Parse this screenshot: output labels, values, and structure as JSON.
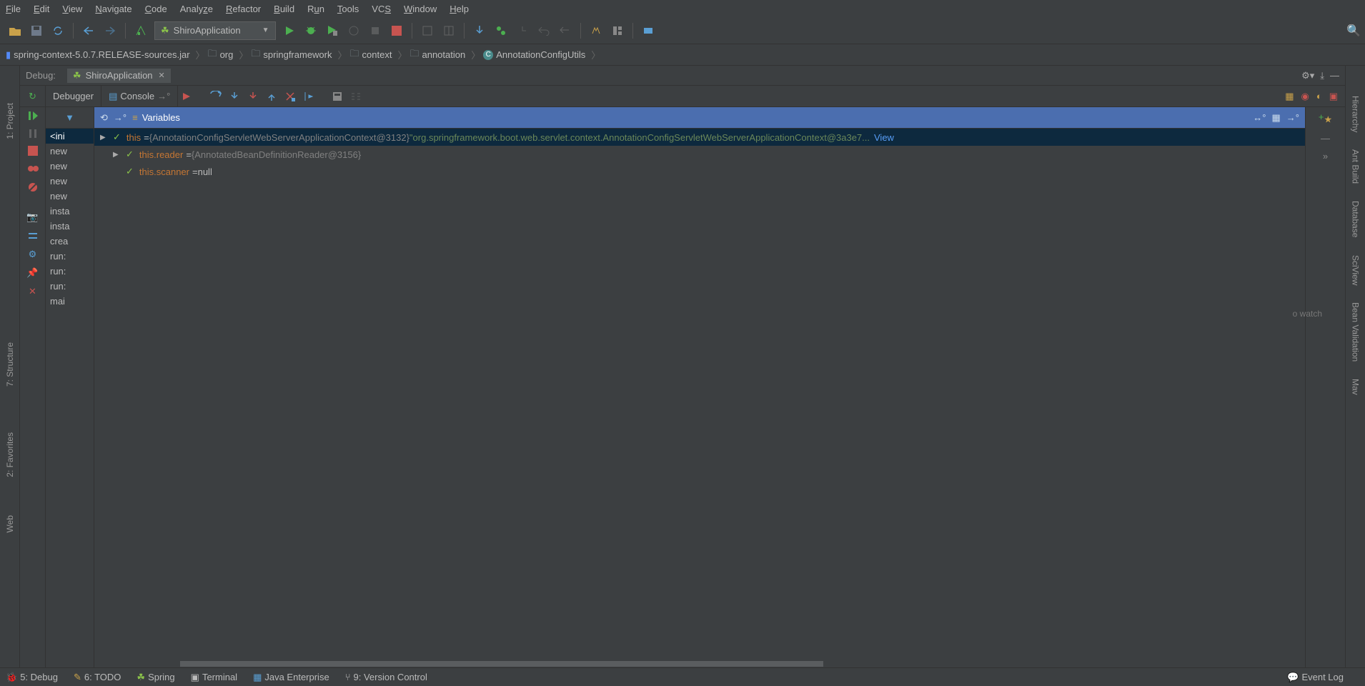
{
  "menu": {
    "file": "File",
    "edit": "Edit",
    "view": "View",
    "navigate": "Navigate",
    "code": "Code",
    "analyze": "Analyze",
    "refactor": "Refactor",
    "build": "Build",
    "run": "Run",
    "tools": "Tools",
    "vcs": "VCS",
    "window": "Window",
    "help": "Help"
  },
  "runConfig": {
    "name": "ShiroApplication"
  },
  "breadcrumb": [
    {
      "icon": "archive",
      "text": "spring-context-5.0.7.RELEASE-sources.jar"
    },
    {
      "icon": "folder",
      "text": "org"
    },
    {
      "icon": "folder",
      "text": "springframework"
    },
    {
      "icon": "folder",
      "text": "context"
    },
    {
      "icon": "folder",
      "text": "annotation"
    },
    {
      "icon": "class",
      "text": "AnnotationConfigUtils"
    }
  ],
  "leftTools": {
    "project": "1: Project",
    "structure": "7: Structure",
    "favorites": "2: Favorites",
    "web": "Web"
  },
  "rightTools": {
    "hierarchy": "Hierarchy",
    "antbuild": "Ant Build",
    "database": "Database",
    "sciview": "SciView",
    "beanval": "Bean Validation",
    "mav": "Mav"
  },
  "debug": {
    "label": "Debug:",
    "tab": "ShiroApplication",
    "debuggerTab": "Debugger",
    "consoleTab": "Console",
    "variablesLabel": "Variables"
  },
  "frames": [
    "<ini",
    "new",
    "new",
    "new",
    "new",
    "insta",
    "insta",
    "crea",
    "run:",
    "run:",
    "run:",
    "mai"
  ],
  "variables": [
    {
      "indent": 0,
      "arrow": "▶",
      "name": "this",
      "eq": " = ",
      "type": "{AnnotationConfigServletWebServerApplicationContext@3132}",
      "str": " \"org.springframework.boot.web.servlet.context.AnnotationConfigServletWebServerApplicationContext@3a3e7...",
      "view": "View",
      "selected": true
    },
    {
      "indent": 1,
      "arrow": "▶",
      "name": "this.reader",
      "eq": " = ",
      "type": "{AnnotatedBeanDefinitionReader@3156}",
      "str": "",
      "view": "",
      "selected": false
    },
    {
      "indent": 1,
      "arrow": "",
      "name": "this.scanner",
      "eq": " = ",
      "type": "",
      "str": "",
      "null": "null",
      "view": "",
      "selected": false
    }
  ],
  "watchHint": "o watch",
  "bottom": {
    "debug": "5: Debug",
    "todo": "6: TODO",
    "spring": "Spring",
    "terminal": "Terminal",
    "javaee": "Java Enterprise",
    "vcs": "9: Version Control",
    "eventlog": "Event Log"
  }
}
